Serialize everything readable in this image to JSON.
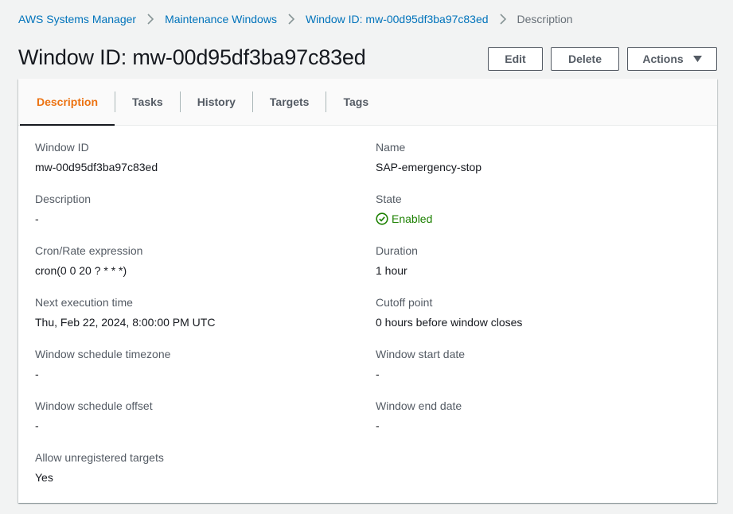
{
  "breadcrumb": {
    "items": [
      {
        "label": "AWS Systems Manager"
      },
      {
        "label": "Maintenance Windows"
      },
      {
        "label": "Window ID: mw-00d95df3ba97c83ed"
      },
      {
        "label": "Description"
      }
    ]
  },
  "header": {
    "title": "Window ID: mw-00d95df3ba97c83ed",
    "edit_label": "Edit",
    "delete_label": "Delete",
    "actions_label": "Actions"
  },
  "tabs": [
    {
      "label": "Description",
      "active": true
    },
    {
      "label": "Tasks"
    },
    {
      "label": "History"
    },
    {
      "label": "Targets"
    },
    {
      "label": "Tags"
    }
  ],
  "details": {
    "window_id": {
      "label": "Window ID",
      "value": "mw-00d95df3ba97c83ed"
    },
    "name": {
      "label": "Name",
      "value": "SAP-emergency-stop"
    },
    "description": {
      "label": "Description",
      "value": "-"
    },
    "state": {
      "label": "State",
      "value": "Enabled",
      "color": "#1d8102",
      "icon": "check-circle-icon"
    },
    "cron": {
      "label": "Cron/Rate expression",
      "value": "cron(0 0 20 ? * * *)"
    },
    "duration": {
      "label": "Duration",
      "value": "1 hour"
    },
    "next_execution": {
      "label": "Next execution time",
      "value": "Thu, Feb 22, 2024, 8:00:00 PM UTC"
    },
    "cutoff": {
      "label": "Cutoff point",
      "value": "0 hours before window closes"
    },
    "timezone": {
      "label": "Window schedule timezone",
      "value": "-"
    },
    "start_date": {
      "label": "Window start date",
      "value": "-"
    },
    "offset": {
      "label": "Window schedule offset",
      "value": "-"
    },
    "end_date": {
      "label": "Window end date",
      "value": "-"
    },
    "unregistered_targets": {
      "label": "Allow unregistered targets",
      "value": "Yes"
    }
  }
}
